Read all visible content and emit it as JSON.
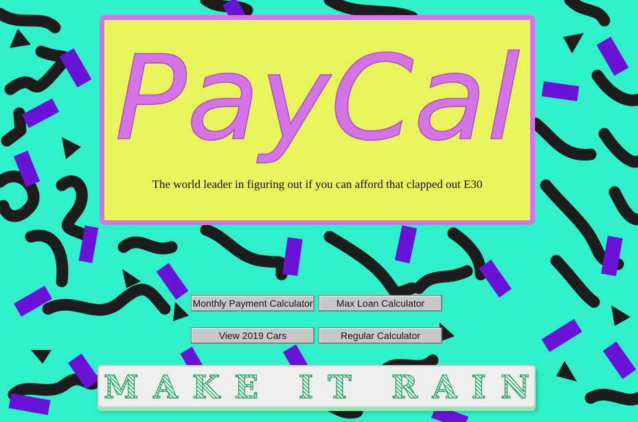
{
  "hero": {
    "logo_text": "PayCal",
    "tagline": "The world leader in figuring out if you can afford that clapped out E30"
  },
  "buttons": {
    "monthly_payment": "Monthly Payment Calculator",
    "max_loan": "Max Loan Calculator",
    "view_cars": "View 2019 Cars",
    "regular_calc": "Regular Calculator"
  },
  "cta": {
    "label": "MAKE IT RAIN"
  },
  "colors": {
    "background": "#2ff0c8",
    "hero_fill": "#e8f45b",
    "hero_border": "#d773e9",
    "squiggle": "#1c1c1c",
    "confetti": "#6a12d8",
    "rain_text": "#27b36a"
  }
}
